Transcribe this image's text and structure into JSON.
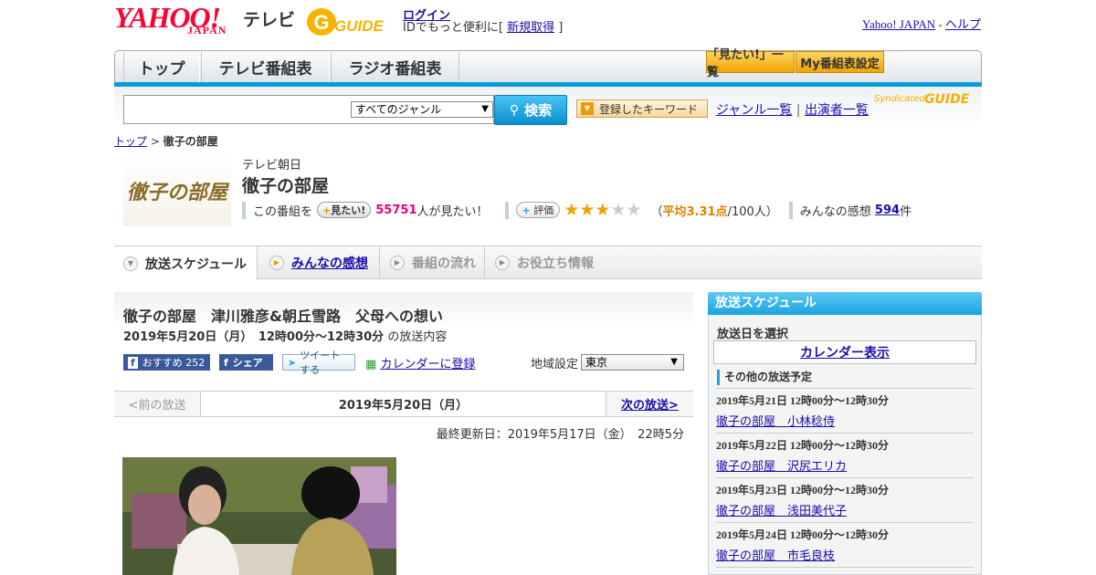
{
  "header": {
    "yahoo_logo": "YAHOO!",
    "yahoo_sub": "JAPAN",
    "tv_label": "テレビ",
    "gguide_logo": "GUIDE",
    "login_label": "ログイン",
    "login_sub_prefix": "IDでもっと便利に[",
    "signup_label": "新規取得",
    "login_sub_suffix": "]",
    "yahoo_japan_link": "Yahoo! JAPAN",
    "sep": "-",
    "help_link": "ヘルプ"
  },
  "nav": {
    "tabs": [
      "トップ",
      "テレビ番組表",
      "ラジオ番組表"
    ],
    "mitai_list": "「見たい!」一覧",
    "my_schedule": "My番組表設定"
  },
  "search": {
    "value": "",
    "genre": "すべてのジャンル",
    "button": "検索",
    "keyword_btn": "登録したキーワード",
    "genre_list": "ジャンル一覧",
    "pipe": "|",
    "performer_list": "出演者一覧",
    "syndicated": "Syndicated"
  },
  "breadcrumb": {
    "top": "トップ",
    "sep": ">",
    "current": "徹子の部屋"
  },
  "program": {
    "thumb_text": "徹子の部屋",
    "channel": "テレビ朝日",
    "title": "徹子の部屋",
    "want_prefix": "この番組を",
    "want_btn": "見たい!",
    "want_count": "55751",
    "want_suffix": "人が見たい！",
    "rating_btn": "評価",
    "rating_stars": 3,
    "rating_total": 5,
    "rating_open": "（",
    "rating_avg": "平均3.31点",
    "rating_people": "/100人）",
    "impressions_prefix": "みんなの感想",
    "impressions_count": "594",
    "impressions_suffix": "件"
  },
  "content_tabs": [
    "放送スケジュール",
    "みんなの感想",
    "番組の流れ",
    "お役立ち情報"
  ],
  "episode": {
    "title": "徹子の部屋　津川雅彦&朝丘雪路　父母への想い",
    "date": "2019年5月20日（月）　12時00分～12時30分",
    "date_suffix": "の放送内容",
    "fb_recommend": "おすすめ",
    "fb_count": "252",
    "fb_share": "シェア",
    "tweet": "ツイートする",
    "calendar_register": "カレンダーに登録",
    "region_label": "地域設定",
    "region": "東京"
  },
  "pager": {
    "prev": "<前の放送",
    "current": "2019年5月20日（月）",
    "next": "次の放送>"
  },
  "updated": "最終更新日：2019年5月17日（金）　22時5分",
  "sidebar": {
    "heading": "放送スケジュール",
    "select_label": "放送日を選択",
    "calendar_btn": "カレンダー表示",
    "other_heading": "その他の放送予定",
    "events": [
      {
        "date": "2019年5月21日  12時00分～12時30分",
        "title": "徹子の部屋　小林稔侍"
      },
      {
        "date": "2019年5月22日  12時00分～12時30分",
        "title": "徹子の部屋　沢尻エリカ"
      },
      {
        "date": "2019年5月23日  12時00分～12時30分",
        "title": "徹子の部屋　浅田美代子"
      },
      {
        "date": "2019年5月24日  12時00分～12時30分",
        "title": "徹子の部屋　市毛良枝"
      }
    ]
  }
}
